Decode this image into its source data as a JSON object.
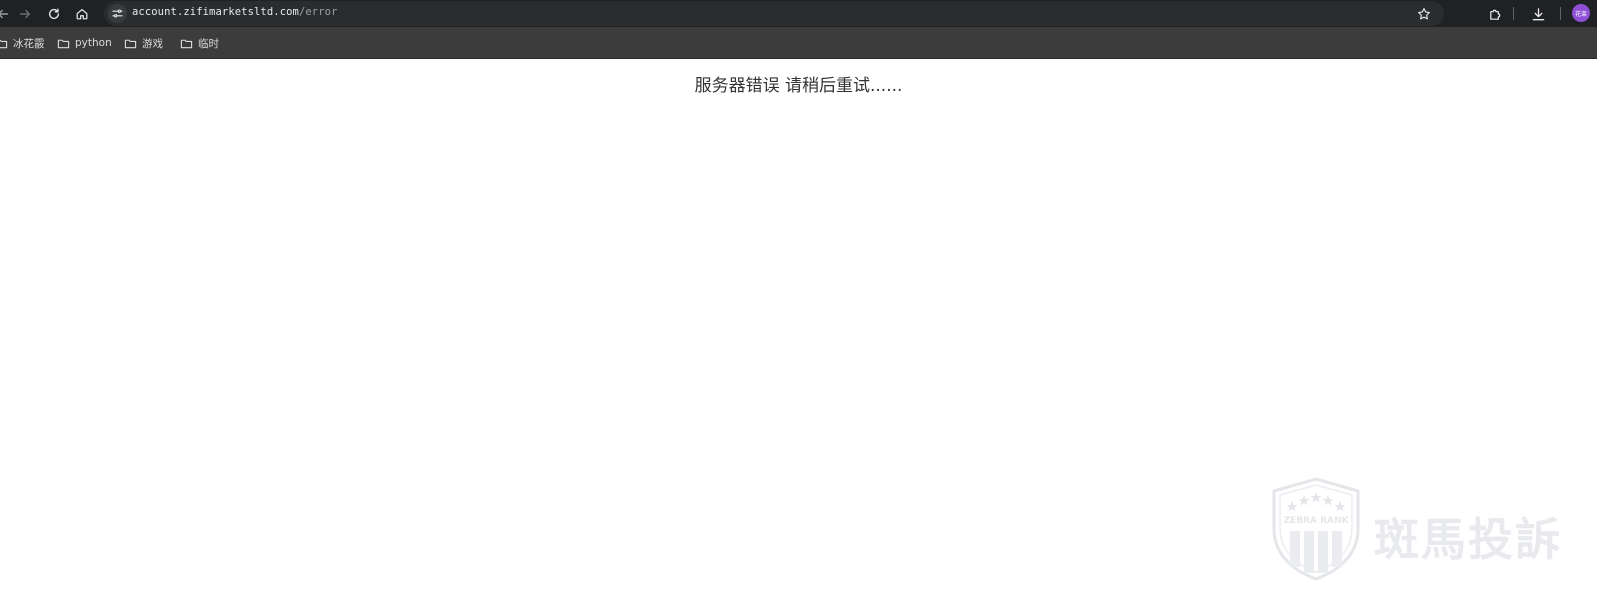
{
  "browser": {
    "url_host": "account.zifimarketsltd.com",
    "url_path": "/error",
    "profile_label": "花束"
  },
  "bookmarks": [
    {
      "label": "冰花霰"
    },
    {
      "label": "python"
    },
    {
      "label": "游戏"
    },
    {
      "label": "临时"
    }
  ],
  "page": {
    "error_message": "服务器错误 请稍后重试......"
  },
  "watermark": {
    "brand_en": "ZEBRA RANK",
    "brand_cn": "斑馬投訴"
  },
  "colors": {
    "toolbar_bg": "#202124",
    "bookmark_bar_bg": "#3c3c3c",
    "avatar": "#8e4fd6",
    "page_bg": "#ffffff"
  }
}
